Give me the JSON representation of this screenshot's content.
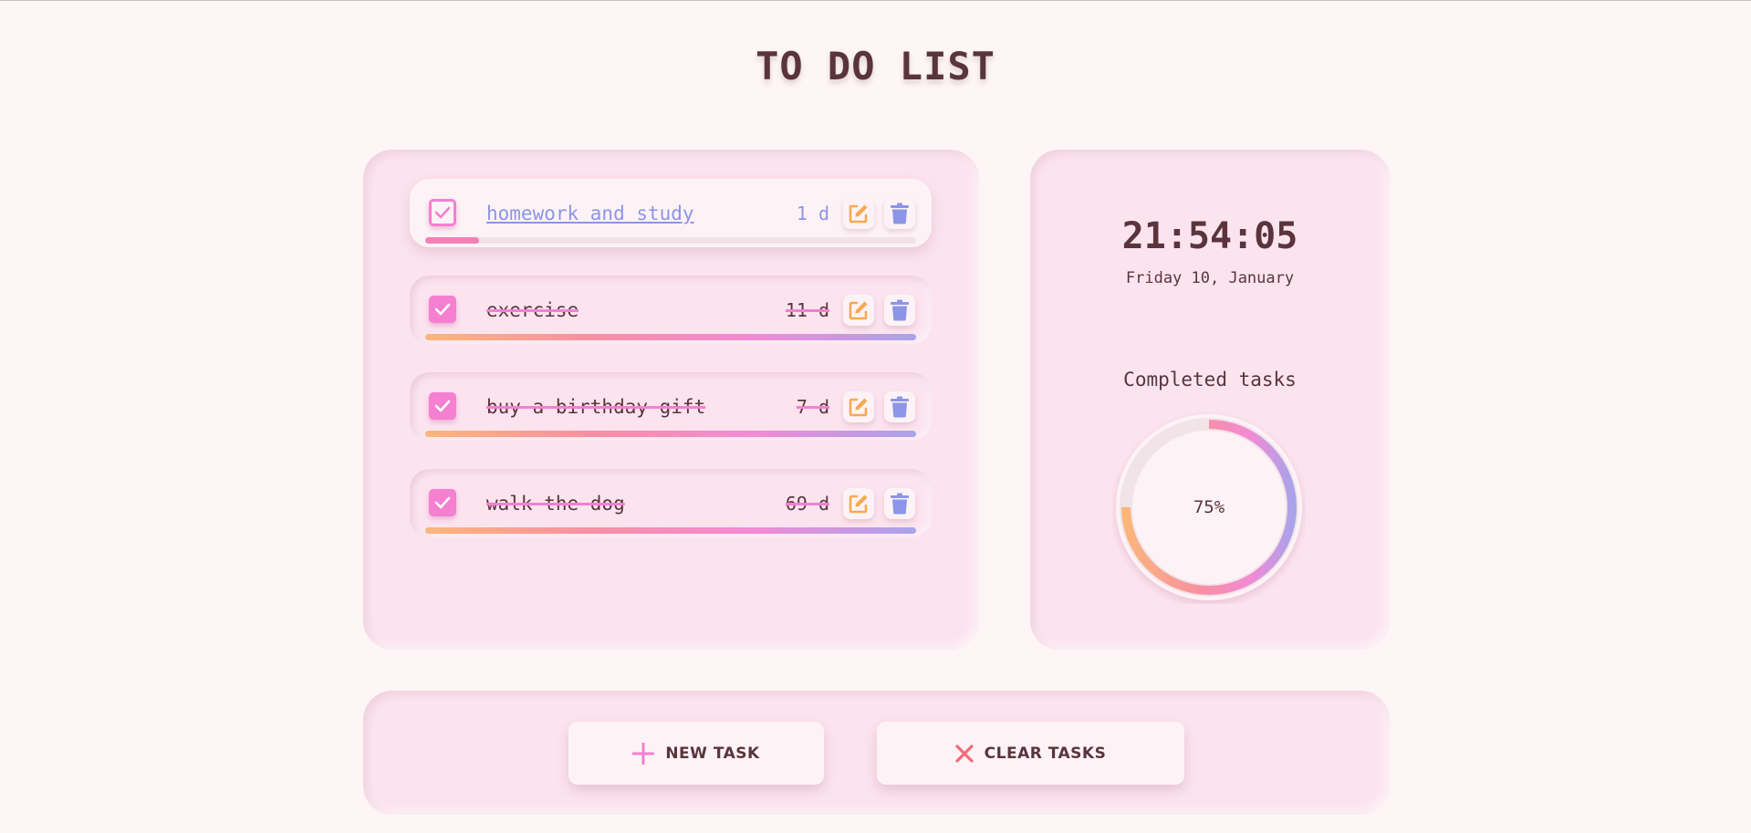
{
  "app": {
    "title": "TO DO LIST"
  },
  "tasks": [
    {
      "label": "homework and study",
      "days": "1 d",
      "done": false,
      "progress": 0.11
    },
    {
      "label": "exercise",
      "days": "11 d",
      "done": true,
      "progress": 1.0
    },
    {
      "label": "buy a birthday gift",
      "days": "7 d",
      "done": true,
      "progress": 1.0
    },
    {
      "label": "walk the dog",
      "days": "69 d",
      "done": true,
      "progress": 1.0
    }
  ],
  "stats": {
    "time": "21:54:05",
    "date": "Friday 10, January",
    "completed_label": "Completed tasks",
    "percent_text": "75%",
    "percent_value": 0.75
  },
  "actions": {
    "new_task": "NEW TASK",
    "clear_tasks": "CLEAR TASKS"
  },
  "icons": {
    "edit": "pencil-square-icon",
    "delete": "trash-icon",
    "check": "checkmark-icon",
    "add": "plus-icon",
    "clear": "x-icon"
  },
  "colors": {
    "background": "#fdf5f6",
    "panel": "#fce4ef",
    "text": "#5a343d",
    "checkbox": "#f57fd1",
    "edit_icon": "#f8a94f",
    "delete_icon": "#8c95e6",
    "clear_icon": "#f26b7a"
  }
}
